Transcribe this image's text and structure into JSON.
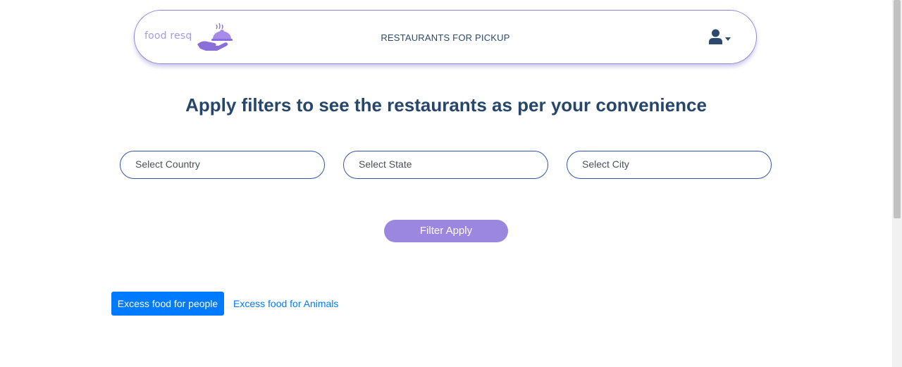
{
  "navbar": {
    "logo_text": "food resq",
    "logo_icon": "hand-serving-food-icon",
    "title": "RESTAURANTS FOR PICKUP",
    "user_icon": "user-icon"
  },
  "main": {
    "heading": "Apply filters to see the restaurants as per your convenience",
    "filters": {
      "country_placeholder": "Select Country",
      "state_placeholder": "Select State",
      "city_placeholder": "Select City"
    },
    "filter_button_label": "Filter Apply"
  },
  "tabs": {
    "people_label": "Excess food for people",
    "animals_label": "Excess food for Animals"
  },
  "colors": {
    "brand_purple": "#9b87e0",
    "primary_blue": "#007bff",
    "heading_navy": "#26476b"
  }
}
